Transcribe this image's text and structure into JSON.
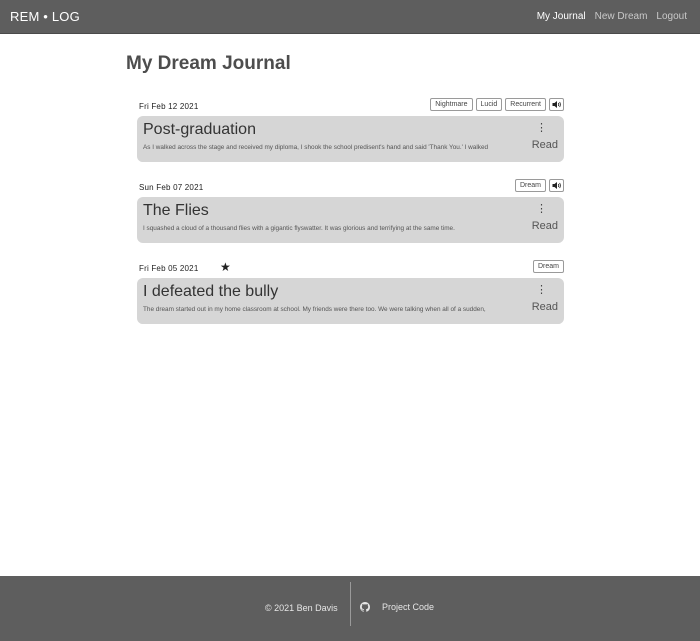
{
  "navbar": {
    "brand": "REM • LOG",
    "links": [
      {
        "label": "My Journal",
        "active": true
      },
      {
        "label": "New Dream",
        "active": false
      },
      {
        "label": "Logout",
        "active": false
      }
    ]
  },
  "main": {
    "title": "My Dream Journal",
    "entries": [
      {
        "date": "Fri Feb 12 2021",
        "starred": false,
        "tags": [
          "Nightmare",
          "Lucid",
          "Recurrent"
        ],
        "has_audio": true,
        "title": "Post-graduation",
        "excerpt": "As I walked across the stage and received my diploma, I shook the school predisent's hand and said 'Thank You.' I walked",
        "read_label": "Read"
      },
      {
        "date": "Sun Feb 07 2021",
        "starred": false,
        "tags": [
          "Dream"
        ],
        "has_audio": true,
        "title": "The Flies",
        "excerpt": "I squashed a cloud of a thousand flies with a gigantic flyswatter. It was glorious and terrifying at the same time.",
        "read_label": "Read"
      },
      {
        "date": "Fri Feb 05 2021",
        "starred": true,
        "tags": [
          "Dream"
        ],
        "has_audio": false,
        "title": "I defeated the bully",
        "excerpt": "The dream started out in my home classroom at school. My friends were there too. We were talking when all of a sudden,",
        "read_label": "Read"
      }
    ]
  },
  "footer": {
    "copyright": "© 2021 Ben Davis",
    "project_link": "Project Code",
    "project_icon": "github-icon"
  },
  "colors": {
    "navbar_bg": "#5e5e5e",
    "card_bg": "#d6d6d6",
    "footer_bg": "#5e5e5e"
  }
}
